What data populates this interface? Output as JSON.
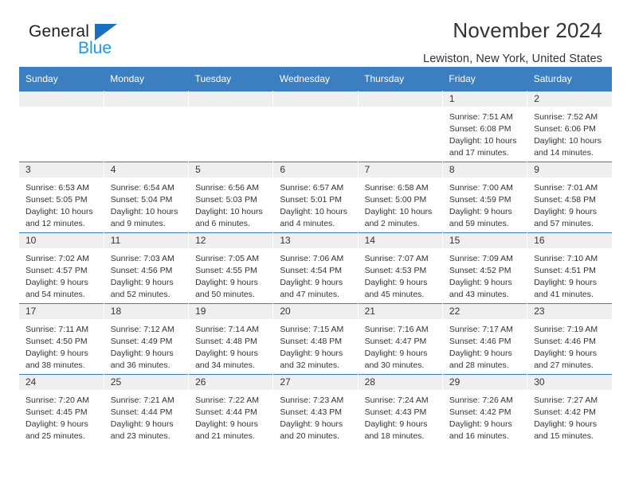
{
  "brand": {
    "name_part1": "General",
    "name_part2": "Blue",
    "triangle_color": "#1b6ec2",
    "blue_color": "#2196e3"
  },
  "header": {
    "title": "November 2024",
    "subtitle": "Lewiston, New York, United States",
    "header_bg": "#3c7fc1",
    "daynum_bg": "#efefef"
  },
  "weekdays": [
    "Sunday",
    "Monday",
    "Tuesday",
    "Wednesday",
    "Thursday",
    "Friday",
    "Saturday"
  ],
  "weeks": [
    [
      {
        "day": "",
        "empty": true
      },
      {
        "day": "",
        "empty": true
      },
      {
        "day": "",
        "empty": true
      },
      {
        "day": "",
        "empty": true
      },
      {
        "day": "",
        "empty": true
      },
      {
        "day": "1",
        "sunrise": "Sunrise: 7:51 AM",
        "sunset": "Sunset: 6:08 PM",
        "daylight1": "Daylight: 10 hours",
        "daylight2": "and 17 minutes."
      },
      {
        "day": "2",
        "sunrise": "Sunrise: 7:52 AM",
        "sunset": "Sunset: 6:06 PM",
        "daylight1": "Daylight: 10 hours",
        "daylight2": "and 14 minutes."
      }
    ],
    [
      {
        "day": "3",
        "sunrise": "Sunrise: 6:53 AM",
        "sunset": "Sunset: 5:05 PM",
        "daylight1": "Daylight: 10 hours",
        "daylight2": "and 12 minutes."
      },
      {
        "day": "4",
        "sunrise": "Sunrise: 6:54 AM",
        "sunset": "Sunset: 5:04 PM",
        "daylight1": "Daylight: 10 hours",
        "daylight2": "and 9 minutes."
      },
      {
        "day": "5",
        "sunrise": "Sunrise: 6:56 AM",
        "sunset": "Sunset: 5:03 PM",
        "daylight1": "Daylight: 10 hours",
        "daylight2": "and 6 minutes."
      },
      {
        "day": "6",
        "sunrise": "Sunrise: 6:57 AM",
        "sunset": "Sunset: 5:01 PM",
        "daylight1": "Daylight: 10 hours",
        "daylight2": "and 4 minutes."
      },
      {
        "day": "7",
        "sunrise": "Sunrise: 6:58 AM",
        "sunset": "Sunset: 5:00 PM",
        "daylight1": "Daylight: 10 hours",
        "daylight2": "and 2 minutes."
      },
      {
        "day": "8",
        "sunrise": "Sunrise: 7:00 AM",
        "sunset": "Sunset: 4:59 PM",
        "daylight1": "Daylight: 9 hours",
        "daylight2": "and 59 minutes."
      },
      {
        "day": "9",
        "sunrise": "Sunrise: 7:01 AM",
        "sunset": "Sunset: 4:58 PM",
        "daylight1": "Daylight: 9 hours",
        "daylight2": "and 57 minutes."
      }
    ],
    [
      {
        "day": "10",
        "sunrise": "Sunrise: 7:02 AM",
        "sunset": "Sunset: 4:57 PM",
        "daylight1": "Daylight: 9 hours",
        "daylight2": "and 54 minutes."
      },
      {
        "day": "11",
        "sunrise": "Sunrise: 7:03 AM",
        "sunset": "Sunset: 4:56 PM",
        "daylight1": "Daylight: 9 hours",
        "daylight2": "and 52 minutes."
      },
      {
        "day": "12",
        "sunrise": "Sunrise: 7:05 AM",
        "sunset": "Sunset: 4:55 PM",
        "daylight1": "Daylight: 9 hours",
        "daylight2": "and 50 minutes."
      },
      {
        "day": "13",
        "sunrise": "Sunrise: 7:06 AM",
        "sunset": "Sunset: 4:54 PM",
        "daylight1": "Daylight: 9 hours",
        "daylight2": "and 47 minutes."
      },
      {
        "day": "14",
        "sunrise": "Sunrise: 7:07 AM",
        "sunset": "Sunset: 4:53 PM",
        "daylight1": "Daylight: 9 hours",
        "daylight2": "and 45 minutes."
      },
      {
        "day": "15",
        "sunrise": "Sunrise: 7:09 AM",
        "sunset": "Sunset: 4:52 PM",
        "daylight1": "Daylight: 9 hours",
        "daylight2": "and 43 minutes."
      },
      {
        "day": "16",
        "sunrise": "Sunrise: 7:10 AM",
        "sunset": "Sunset: 4:51 PM",
        "daylight1": "Daylight: 9 hours",
        "daylight2": "and 41 minutes."
      }
    ],
    [
      {
        "day": "17",
        "sunrise": "Sunrise: 7:11 AM",
        "sunset": "Sunset: 4:50 PM",
        "daylight1": "Daylight: 9 hours",
        "daylight2": "and 38 minutes."
      },
      {
        "day": "18",
        "sunrise": "Sunrise: 7:12 AM",
        "sunset": "Sunset: 4:49 PM",
        "daylight1": "Daylight: 9 hours",
        "daylight2": "and 36 minutes."
      },
      {
        "day": "19",
        "sunrise": "Sunrise: 7:14 AM",
        "sunset": "Sunset: 4:48 PM",
        "daylight1": "Daylight: 9 hours",
        "daylight2": "and 34 minutes."
      },
      {
        "day": "20",
        "sunrise": "Sunrise: 7:15 AM",
        "sunset": "Sunset: 4:48 PM",
        "daylight1": "Daylight: 9 hours",
        "daylight2": "and 32 minutes."
      },
      {
        "day": "21",
        "sunrise": "Sunrise: 7:16 AM",
        "sunset": "Sunset: 4:47 PM",
        "daylight1": "Daylight: 9 hours",
        "daylight2": "and 30 minutes."
      },
      {
        "day": "22",
        "sunrise": "Sunrise: 7:17 AM",
        "sunset": "Sunset: 4:46 PM",
        "daylight1": "Daylight: 9 hours",
        "daylight2": "and 28 minutes."
      },
      {
        "day": "23",
        "sunrise": "Sunrise: 7:19 AM",
        "sunset": "Sunset: 4:46 PM",
        "daylight1": "Daylight: 9 hours",
        "daylight2": "and 27 minutes."
      }
    ],
    [
      {
        "day": "24",
        "sunrise": "Sunrise: 7:20 AM",
        "sunset": "Sunset: 4:45 PM",
        "daylight1": "Daylight: 9 hours",
        "daylight2": "and 25 minutes."
      },
      {
        "day": "25",
        "sunrise": "Sunrise: 7:21 AM",
        "sunset": "Sunset: 4:44 PM",
        "daylight1": "Daylight: 9 hours",
        "daylight2": "and 23 minutes."
      },
      {
        "day": "26",
        "sunrise": "Sunrise: 7:22 AM",
        "sunset": "Sunset: 4:44 PM",
        "daylight1": "Daylight: 9 hours",
        "daylight2": "and 21 minutes."
      },
      {
        "day": "27",
        "sunrise": "Sunrise: 7:23 AM",
        "sunset": "Sunset: 4:43 PM",
        "daylight1": "Daylight: 9 hours",
        "daylight2": "and 20 minutes."
      },
      {
        "day": "28",
        "sunrise": "Sunrise: 7:24 AM",
        "sunset": "Sunset: 4:43 PM",
        "daylight1": "Daylight: 9 hours",
        "daylight2": "and 18 minutes."
      },
      {
        "day": "29",
        "sunrise": "Sunrise: 7:26 AM",
        "sunset": "Sunset: 4:42 PM",
        "daylight1": "Daylight: 9 hours",
        "daylight2": "and 16 minutes."
      },
      {
        "day": "30",
        "sunrise": "Sunrise: 7:27 AM",
        "sunset": "Sunset: 4:42 PM",
        "daylight1": "Daylight: 9 hours",
        "daylight2": "and 15 minutes."
      }
    ]
  ]
}
